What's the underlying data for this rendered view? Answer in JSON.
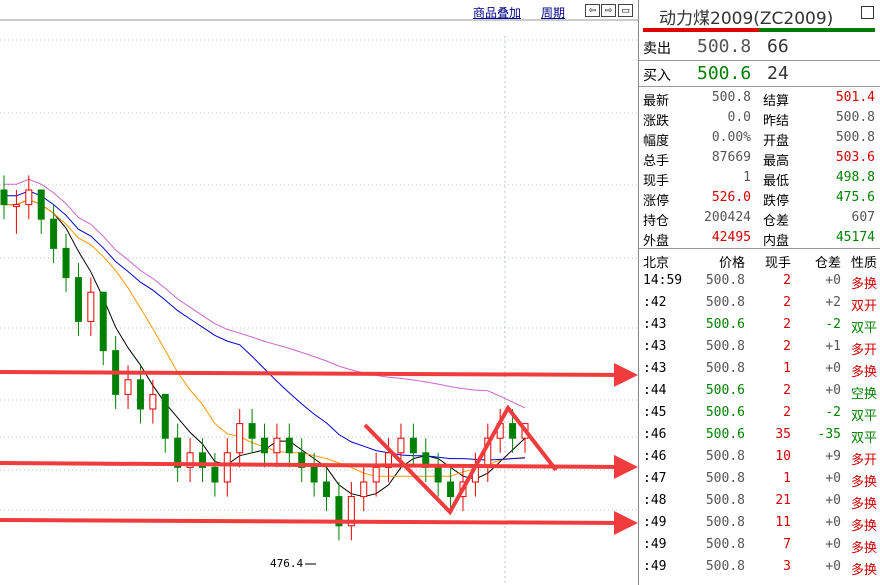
{
  "toolbar": {
    "overlay_label": "商品叠加",
    "period_label": "周期",
    "btn_prev": "⇦",
    "btn_next": "⇨",
    "btn_window": "▭"
  },
  "chart": {
    "low_label": "476.4"
  },
  "colors": {
    "up": "#e60000",
    "down": "#008000",
    "ma1": "#000000",
    "ma2": "#ff9900",
    "ma3": "#0000cc",
    "ma4": "#cc66cc",
    "annotation": "#f03c3c"
  },
  "panel": {
    "title": "动力煤2009(ZC2009)",
    "ask_label": "卖出",
    "ask_price": "500.8",
    "ask_volume": "66",
    "bid_label": "买入",
    "bid_price": "500.6",
    "bid_volume": "24",
    "stats": [
      {
        "l1": "最新",
        "v1": "500.8",
        "c1": "grey",
        "l2": "结算",
        "v2": "501.4",
        "c2": "red"
      },
      {
        "l1": "涨跌",
        "v1": "0.0",
        "c1": "grey",
        "l2": "昨结",
        "v2": "500.8",
        "c2": "grey"
      },
      {
        "l1": "幅度",
        "v1": "0.00%",
        "c1": "grey",
        "l2": "开盘",
        "v2": "500.8",
        "c2": "grey"
      },
      {
        "l1": "总手",
        "v1": "87669",
        "c1": "grey",
        "l2": "最高",
        "v2": "503.6",
        "c2": "red"
      },
      {
        "l1": "现手",
        "v1": "1",
        "c1": "grey",
        "l2": "最低",
        "v2": "498.8",
        "c2": "green"
      },
      {
        "l1": "涨停",
        "v1": "526.0",
        "c1": "red",
        "l2": "跌停",
        "v2": "475.6",
        "c2": "green"
      },
      {
        "l1": "持仓",
        "v1": "200424",
        "c1": "grey",
        "l2": "仓差",
        "v2": "607",
        "c2": "grey"
      },
      {
        "l1": "外盘",
        "v1": "42495",
        "c1": "red",
        "l2": "内盘",
        "v2": "45174",
        "c2": "green"
      }
    ],
    "ticks_header": {
      "time": "北京",
      "price": "价格",
      "vol": "现手",
      "oi": "仓差",
      "type": "性质"
    },
    "ticks": [
      {
        "time": "14:59",
        "price": "500.8",
        "pc": "grey",
        "vol": "2",
        "oi": "+0",
        "type": "多换",
        "tc": "red"
      },
      {
        "time": ":42",
        "price": "500.8",
        "pc": "grey",
        "vol": "2",
        "oi": "+2",
        "type": "双开",
        "tc": "red"
      },
      {
        "time": ":43",
        "price": "500.6",
        "pc": "green",
        "vol": "2",
        "oi": "-2",
        "type": "双平",
        "tc": "green"
      },
      {
        "time": ":43",
        "price": "500.8",
        "pc": "grey",
        "vol": "2",
        "oi": "+1",
        "type": "多开",
        "tc": "red"
      },
      {
        "time": ":43",
        "price": "500.8",
        "pc": "grey",
        "vol": "1",
        "oi": "+0",
        "type": "多换",
        "tc": "red"
      },
      {
        "time": ":44",
        "price": "500.6",
        "pc": "green",
        "vol": "2",
        "oi": "+0",
        "type": "空换",
        "tc": "green"
      },
      {
        "time": ":45",
        "price": "500.6",
        "pc": "green",
        "vol": "2",
        "oi": "-2",
        "type": "双平",
        "tc": "green"
      },
      {
        "time": ":46",
        "price": "500.6",
        "pc": "green",
        "vol": "35",
        "oi": "-35",
        "type": "双平",
        "tc": "green"
      },
      {
        "time": ":46",
        "price": "500.8",
        "pc": "grey",
        "vol": "10",
        "oi": "+9",
        "type": "多开",
        "tc": "red"
      },
      {
        "time": ":47",
        "price": "500.8",
        "pc": "grey",
        "vol": "1",
        "oi": "+0",
        "type": "多换",
        "tc": "red"
      },
      {
        "time": ":48",
        "price": "500.8",
        "pc": "grey",
        "vol": "21",
        "oi": "+0",
        "type": "多换",
        "tc": "red"
      },
      {
        "time": ":49",
        "price": "500.8",
        "pc": "grey",
        "vol": "11",
        "oi": "+0",
        "type": "多换",
        "tc": "red"
      },
      {
        "time": ":49",
        "price": "500.8",
        "pc": "grey",
        "vol": "7",
        "oi": "+0",
        "type": "多换",
        "tc": "red"
      },
      {
        "time": ":49",
        "price": "500.8",
        "pc": "grey",
        "vol": "3",
        "oi": "+0",
        "type": "多换",
        "tc": "red"
      }
    ]
  }
}
